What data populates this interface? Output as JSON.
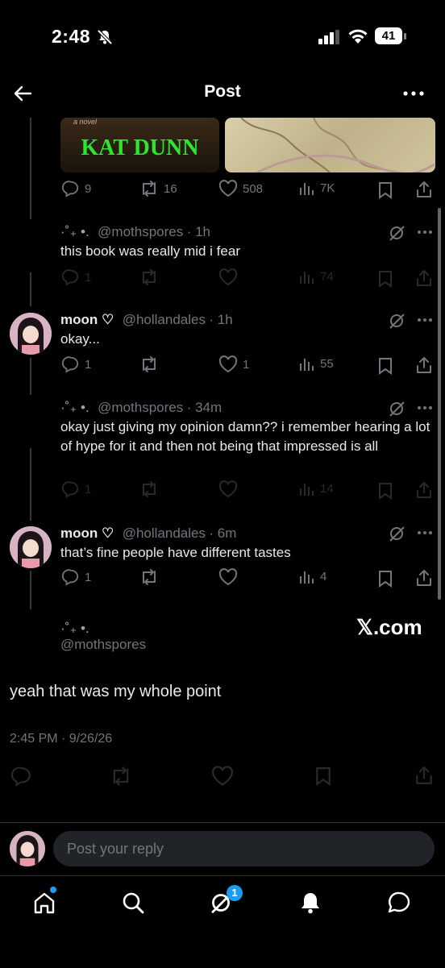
{
  "status_bar": {
    "time": "2:48",
    "battery": "41"
  },
  "header": {
    "title": "Post"
  },
  "top_post": {
    "book_title": "KAT DUNN",
    "book_tag": "a novel",
    "stats": {
      "replies": "9",
      "reposts": "16",
      "likes": "508",
      "views": "7K"
    }
  },
  "replies": [
    {
      "name": "·˚₊ •.",
      "handle": "@mothspores",
      "time": "· 1h",
      "text": "this book was really mid i fear",
      "replies": "1",
      "reposts": "",
      "likes": "",
      "views": "74"
    },
    {
      "name": "moon ♡",
      "handle": "@hollandales",
      "time": "· 1h",
      "text": "okay...",
      "replies": "1",
      "reposts": "",
      "likes": "1",
      "views": "55"
    },
    {
      "name": "·˚₊ •.",
      "handle": "@mothspores",
      "time": "· 34m",
      "text": "okay just giving my opinion damn?? i remember hearing a lot of hype for it and then not being that impressed is all",
      "replies": "1",
      "reposts": "",
      "likes": "",
      "views": "14"
    },
    {
      "name": "moon ♡",
      "handle": "@hollandales",
      "time": "· 6m",
      "text": "that’s fine people have different tastes",
      "replies": "1",
      "reposts": "",
      "likes": "",
      "views": "4"
    }
  ],
  "focused_post": {
    "name": "·˚₊ •.",
    "handle": "@mothspores",
    "watermark": "𝕏.com",
    "text": "yeah that was my whole point",
    "timestamp": "2:45 PM · 9/26/26"
  },
  "reply_box": {
    "placeholder": "Post your reply"
  },
  "tab_bar": {
    "notification_badge": "1"
  },
  "colors": {
    "background": "#000000",
    "accent": "#1d9bf0",
    "muted": "#71767b"
  }
}
